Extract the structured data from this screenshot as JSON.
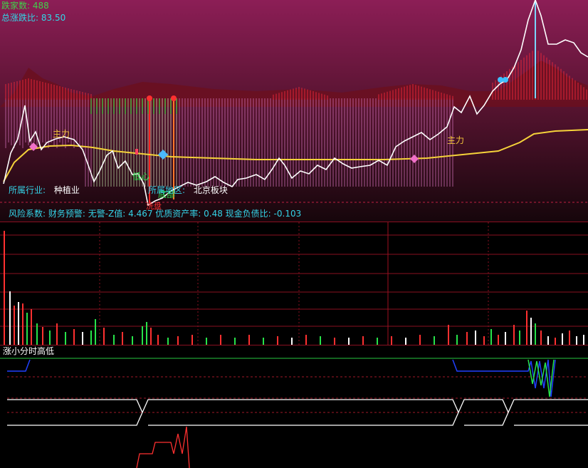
{
  "stats": {
    "fall_count_label": "跌家数:",
    "fall_count_value": "488",
    "ratio_label": "总涨跌比:",
    "ratio_value": "83.50"
  },
  "info": {
    "industry_label": "所属行业:",
    "industry_value": "种植业",
    "region_label": "所属地区:",
    "region_value": "北京板块",
    "risk_line": "风险系数: 财务预警: 无警-Z值: 4.467 优质资产率: 0.48 现金负债比: -0.103"
  },
  "annotations": {
    "main_force_left": "主力",
    "main_force_right": "主力",
    "green_tag": "低心",
    "green_tag2": "底部",
    "red_tag": "洗盘"
  },
  "indicator": {
    "title": "涨小分时高低"
  },
  "colors": {
    "main_bg_top": "#7a1a4a",
    "main_bg_bottom": "#1a0508",
    "price_line": "#ffffff",
    "ma_line": "#f5d23a",
    "grid": "#8a1020"
  }
}
